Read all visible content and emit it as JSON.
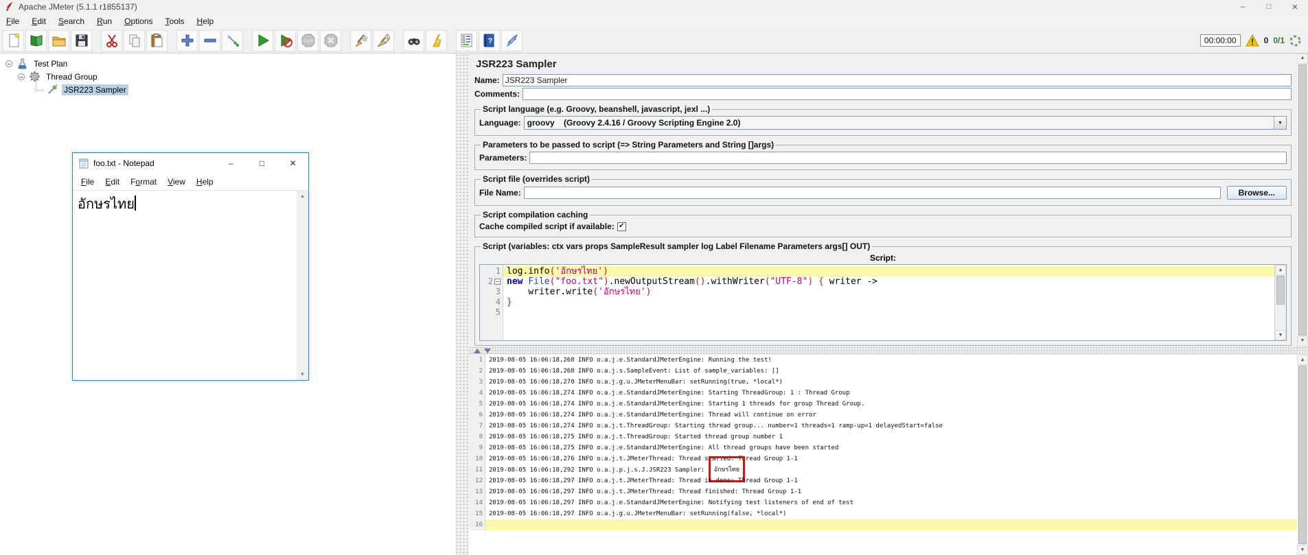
{
  "window": {
    "title": "Apache JMeter (5.1.1 r1855137)",
    "timer": "00:00:00",
    "log_error_count": "0",
    "thread_count": "0/1"
  },
  "menu": [
    {
      "label": "File",
      "mn": 0
    },
    {
      "label": "Edit",
      "mn": 0
    },
    {
      "label": "Search",
      "mn": 0
    },
    {
      "label": "Run",
      "mn": 0
    },
    {
      "label": "Options",
      "mn": 0
    },
    {
      "label": "Tools",
      "mn": 0
    },
    {
      "label": "Help",
      "mn": 0
    }
  ],
  "toolbar": [
    "new-file-icon",
    "templates-icon",
    "open-file-icon",
    "save-icon",
    "sep",
    "cut-icon",
    "copy-icon",
    "paste-icon",
    "sep",
    "expand-icon",
    "collapse-icon",
    "toggle-icon",
    "sep",
    "start-icon",
    "start-no-timers-icon",
    "stop-icon",
    "shutdown-icon",
    "sep",
    "clear-icon",
    "clear-all-icon",
    "sep",
    "search-icon",
    "search-reset-icon",
    "sep",
    "function-helper-icon",
    "help-icon",
    "apache-feather-icon"
  ],
  "tree": {
    "items": [
      {
        "label": "Test Plan",
        "icon": "testplan-flask-icon",
        "level": 0,
        "knob": true,
        "selected": false
      },
      {
        "label": "Thread Group",
        "icon": "threadgroup-gear-icon",
        "level": 1,
        "knob": true,
        "selected": false
      },
      {
        "label": "JSR223 Sampler",
        "icon": "sampler-dropper-icon",
        "level": 2,
        "knob": false,
        "selected": true
      }
    ]
  },
  "panel": {
    "title": "JSR223 Sampler",
    "name_label": "Name:",
    "name_value": "JSR223 Sampler",
    "comments_label": "Comments:",
    "comments_value": "",
    "lang_group": "Script language (e.g. Groovy, beanshell, javascript, jexl ...)",
    "lang_label": "Language:",
    "lang_value": "groovy    (Groovy 2.4.16 / Groovy Scripting Engine 2.0)",
    "params_group": "Parameters to be passed to script (=> String Parameters and String []args)",
    "params_label": "Parameters:",
    "params_value": "",
    "file_group": "Script file (overrides script)",
    "file_label": "File Name:",
    "file_value": "",
    "browse_label": "Browse...",
    "cache_group": "Script compilation caching",
    "cache_label": "Cache compiled script if available:",
    "cache_checked": true,
    "script_group": "Script (variables: ctx vars props SampleResult sampler log Label Filename Parameters args[] OUT)",
    "script_label": "Script:",
    "script_lines": [
      {
        "num": 1,
        "highlight": true,
        "fold": false,
        "tokens": [
          {
            "c": "plain",
            "t": "log.info"
          },
          {
            "c": "sep",
            "t": "("
          },
          {
            "c": "str",
            "t": "'อักษรไทย'"
          },
          {
            "c": "sep",
            "t": ")"
          }
        ]
      },
      {
        "num": 2,
        "highlight": false,
        "fold": true,
        "tokens": [
          {
            "c": "kw",
            "t": "new"
          },
          {
            "c": "plain",
            "t": " "
          },
          {
            "c": "cls",
            "t": "File"
          },
          {
            "c": "sep",
            "t": "("
          },
          {
            "c": "str",
            "t": "\"foo.txt\""
          },
          {
            "c": "sep",
            "t": ")"
          },
          {
            "c": "plain",
            "t": ".newOutputStream"
          },
          {
            "c": "sep",
            "t": "()"
          },
          {
            "c": "plain",
            "t": ".withWriter"
          },
          {
            "c": "sep",
            "t": "("
          },
          {
            "c": "str",
            "t": "\"UTF-8\""
          },
          {
            "c": "sep",
            "t": ")"
          },
          {
            "c": "plain",
            "t": " "
          },
          {
            "c": "sep",
            "t": "{"
          },
          {
            "c": "plain",
            "t": " writer ->"
          }
        ]
      },
      {
        "num": 3,
        "highlight": false,
        "fold": false,
        "tokens": [
          {
            "c": "plain",
            "t": "    writer.write"
          },
          {
            "c": "sep",
            "t": "("
          },
          {
            "c": "str",
            "t": "'อักษรไทย'"
          },
          {
            "c": "sep",
            "t": ")"
          }
        ]
      },
      {
        "num": 4,
        "highlight": false,
        "fold": false,
        "tokens": [
          {
            "c": "sep",
            "t": "}"
          }
        ]
      },
      {
        "num": 5,
        "highlight": false,
        "fold": false,
        "tokens": []
      }
    ]
  },
  "log": {
    "lines": [
      {
        "n": 1,
        "text": "2019-08-05 16:06:18,268 INFO o.a.j.e.StandardJMeterEngine: Running the test!"
      },
      {
        "n": 2,
        "text": "2019-08-05 16:06:18,268 INFO o.a.j.s.SampleEvent: List of sample_variables: []"
      },
      {
        "n": 3,
        "text": "2019-08-05 16:06:18,270 INFO o.a.j.g.u.JMeterMenuBar: setRunning(true, *local*)"
      },
      {
        "n": 4,
        "text": "2019-08-05 16:06:18,274 INFO o.a.j.e.StandardJMeterEngine: Starting ThreadGroup: 1 : Thread Group"
      },
      {
        "n": 5,
        "text": "2019-08-05 16:06:18,274 INFO o.a.j.e.StandardJMeterEngine: Starting 1 threads for group Thread Group."
      },
      {
        "n": 6,
        "text": "2019-08-05 16:06:18,274 INFO o.a.j.e.StandardJMeterEngine: Thread will continue on error"
      },
      {
        "n": 7,
        "text": "2019-08-05 16:06:18,274 INFO o.a.j.t.ThreadGroup: Starting thread group... number=1 threads=1 ramp-up=1 delayedStart=false"
      },
      {
        "n": 8,
        "text": "2019-08-05 16:06:18,275 INFO o.a.j.t.ThreadGroup: Started thread group number 1"
      },
      {
        "n": 9,
        "text": "2019-08-05 16:06:18,275 INFO o.a.j.e.StandardJMeterEngine: All thread groups have been started"
      },
      {
        "n": 10,
        "text": "2019-08-05 16:06:18,276 INFO o.a.j.t.JMeterThread: Thread started: Thread Group 1-1"
      },
      {
        "n": 11,
        "text": "2019-08-05 16:06:18,292 INFO o.a.j.p.j.s.J.JSR223 Sampler: ",
        "boxed": "อักษรไทย"
      },
      {
        "n": 12,
        "text": "2019-08-05 16:06:18,297 INFO o.a.j.t.JMeterThread: Thread is done: Thread Group 1-1"
      },
      {
        "n": 13,
        "text": "2019-08-05 16:06:18,297 INFO o.a.j.t.JMeterThread: Thread finished: Thread Group 1-1"
      },
      {
        "n": 14,
        "text": "2019-08-05 16:06:18,297 INFO o.a.j.e.StandardJMeterEngine: Notifying test listeners of end of test"
      },
      {
        "n": 15,
        "text": "2019-08-05 16:06:18,297 INFO o.a.j.g.u.JMeterMenuBar: setRunning(false, *local*)"
      },
      {
        "n": 16,
        "text": "",
        "highlight": true
      }
    ]
  },
  "notepad": {
    "title": "foo.txt - Notepad",
    "menu": [
      {
        "label": "File",
        "mn": 0
      },
      {
        "label": "Edit",
        "mn": 0
      },
      {
        "label": "Format",
        "mn": 1
      },
      {
        "label": "View",
        "mn": 0
      },
      {
        "label": "Help",
        "mn": 0
      }
    ],
    "content": "อักษรไทย"
  },
  "colors": {
    "selection": "#b9cfe4",
    "current_line_highlight": "#faf8ab",
    "annotation_red": "#dd1111",
    "syntax_keyword": "#0000c0",
    "syntax_class": "#1a3fbf",
    "syntax_string": "#c4007a",
    "syntax_separator": "#b22222",
    "notepad_border": "#2f86d2",
    "thread_count_green": "#357a38",
    "warning_yellow": "#f0c000"
  }
}
